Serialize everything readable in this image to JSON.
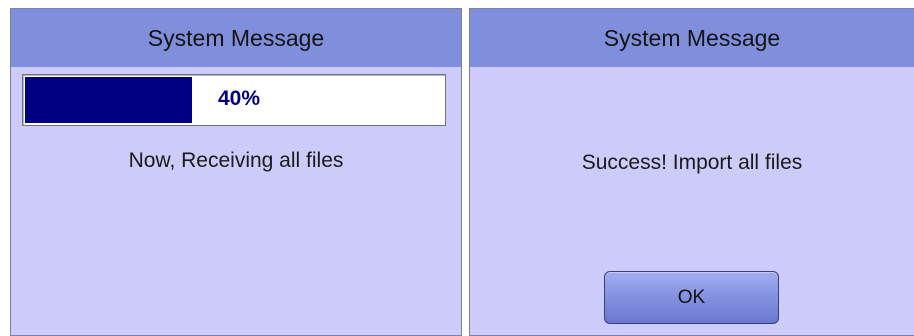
{
  "dialogs": [
    {
      "title": "System Message",
      "progress": {
        "percent": 40,
        "label": "40%"
      },
      "message": "Now, Receiving all files"
    },
    {
      "title": "System Message",
      "message": "Success! Import all files",
      "ok_label": "OK"
    }
  ],
  "colors": {
    "title_bar": "#7f8fdc",
    "dialog_body": "#cccbf9",
    "progress_fill": "#000080",
    "progress_track": "#ffffff",
    "button": "#8391e0"
  }
}
